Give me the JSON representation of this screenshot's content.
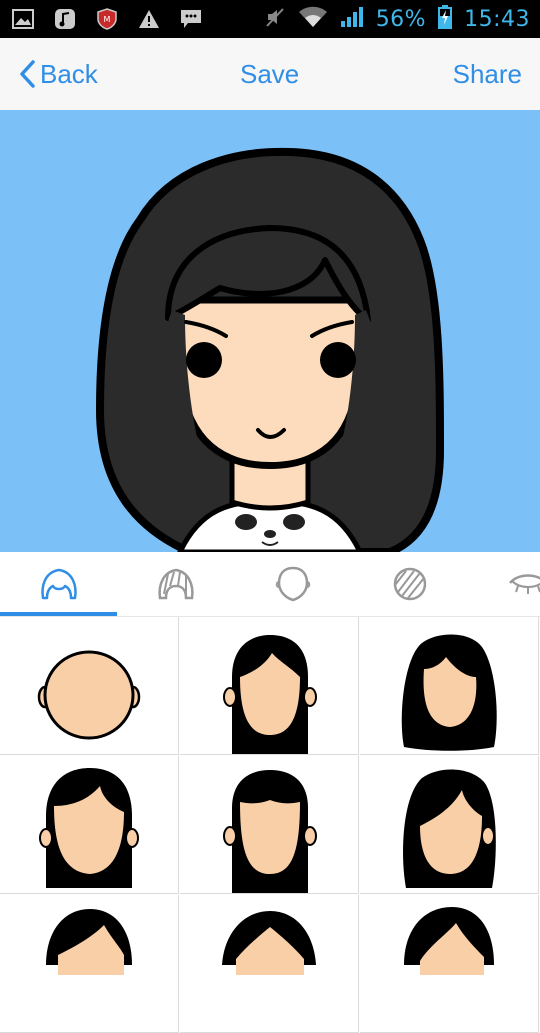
{
  "status_bar": {
    "battery": "56%",
    "time": "15:43",
    "icons": [
      "gallery-icon",
      "music-icon",
      "antivirus-icon",
      "warning-icon",
      "message-icon",
      "mute-icon",
      "wifi-icon",
      "signal-icon",
      "battery-charging-icon"
    ]
  },
  "nav": {
    "back_label": "Back",
    "save_label": "Save",
    "share_label": "Share"
  },
  "colors": {
    "accent": "#2f8ee5",
    "canvas_bg": "#7cc0f8",
    "hair": "#2b2b2b",
    "skin": "#fcdcbc",
    "status_bar_text": "#3fb7ea"
  },
  "tabs": [
    {
      "icon": "hairstyle-icon",
      "selected": true
    },
    {
      "icon": "hair-texture-icon",
      "selected": false
    },
    {
      "icon": "face-shape-icon",
      "selected": false
    },
    {
      "icon": "hair-pattern-icon",
      "selected": false
    },
    {
      "icon": "eyes-icon",
      "selected": false
    }
  ],
  "hairstyle_options": [
    {
      "style": "bald"
    },
    {
      "style": "long-straight-side-part"
    },
    {
      "style": "long-wavy-covering-ears"
    },
    {
      "style": "shoulder-side-swept"
    },
    {
      "style": "long-with-bangs"
    },
    {
      "style": "side-swept-bob"
    },
    {
      "style": "short-side-part"
    },
    {
      "style": "center-part"
    },
    {
      "style": "side-part-volume"
    }
  ]
}
